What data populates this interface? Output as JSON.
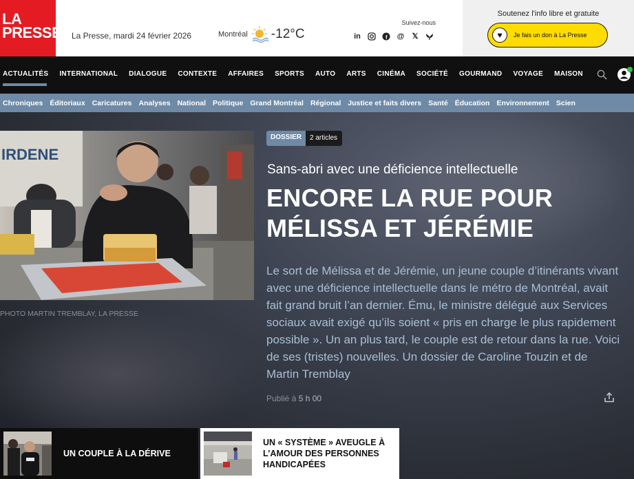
{
  "header": {
    "logo": {
      "line1": "LA",
      "line2": "PRESSE"
    },
    "dateline": "La Presse, mardi 24 février 2026",
    "weather": {
      "city": "Montréal",
      "temperature": "-12°C",
      "icon": "sun-cloud-icon"
    },
    "social": {
      "label": "Suivez-nous",
      "icons": [
        "linkedin-icon",
        "instagram-icon",
        "facebook-icon",
        "threads-icon",
        "x-icon",
        "bluesky-icon"
      ]
    },
    "support": {
      "text": "Soutenez l'info libre et gratuite",
      "button_label": "Je fais un don à La Presse"
    }
  },
  "nav": {
    "items": [
      "ACTUALITÉS",
      "INTERNATIONAL",
      "DIALOGUE",
      "CONTEXTE",
      "AFFAIRES",
      "SPORTS",
      "AUTO",
      "ARTS",
      "CINÉMA",
      "SOCIÉTÉ",
      "GOURMAND",
      "VOYAGE",
      "MAISON"
    ],
    "active": "ACTUALITÉS"
  },
  "subnav": {
    "items": [
      "Chroniques",
      "Éditoriaux",
      "Caricatures",
      "Analyses",
      "National",
      "Politique",
      "Grand Montréal",
      "Régional",
      "Justice et faits divers",
      "Santé",
      "Éducation",
      "Environnement",
      "Scien"
    ]
  },
  "hero": {
    "badge_label": "DOSSIER",
    "badge_count": "2 articles",
    "kicker": "Sans-abri avec une déficience intellectuelle",
    "headline_line1": "ENCORE LA RUE POUR",
    "headline_line2": "MÉLISSA ET JÉRÉMIE",
    "summary": "Le sort de Mélissa et de Jérémie, un jeune couple d’itinérants vivant avec une déficience intellectuelle dans le métro de Montréal, avait fait grand bruit l’an dernier. Ému, le ministre délégué aux Services sociaux avait exigé qu’ils soient « pris en charge le plus rapidement possible ». Un an plus tard, le couple est de retour dans la rue. Voici de ses (tristes) nouvelles. Un dossier de Caroline Touzin et de Martin Tremblay",
    "photo_credit": "PHOTO MARTIN TREMBLAY, LA PRESSE",
    "published_prefix": "Publié à",
    "published_time": "5 h 00"
  },
  "cards": [
    {
      "title": "UN COUPLE À LA DÉRIVE"
    },
    {
      "title": "UN « SYSTÈME » AVEUGLE À L’AMOUR DES PERSONNES HANDICAPÉES"
    }
  ],
  "colors": {
    "brand_red": "#e41b23",
    "nav_bg": "#101010",
    "subnav_bg": "#6e8aa6",
    "donate_yellow": "#ffdc00",
    "summary_text": "#a9bfd6"
  }
}
